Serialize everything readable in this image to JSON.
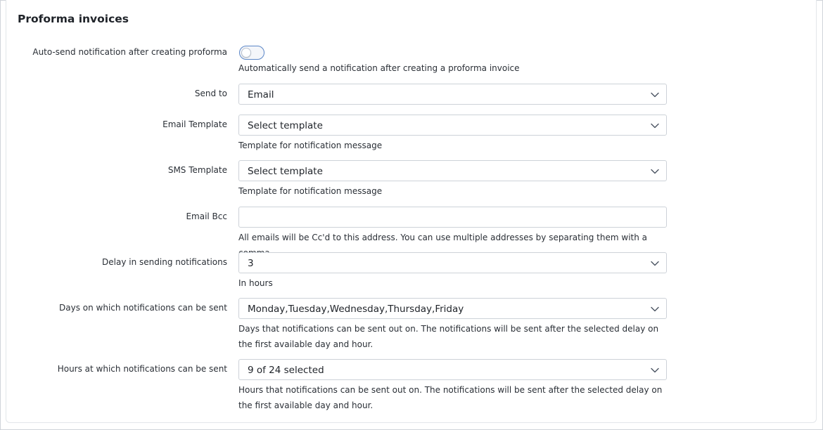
{
  "section": {
    "title": "Proforma invoices"
  },
  "auto_send": {
    "label": "Auto-send notification after creating proforma",
    "enabled": false,
    "help": "Automatically send a notification after creating a proforma invoice"
  },
  "send_to": {
    "label": "Send to",
    "value": "Email"
  },
  "email_template": {
    "label": "Email Template",
    "value": "Select template",
    "help": "Template for notification message"
  },
  "sms_template": {
    "label": "SMS Template",
    "value": "Select template",
    "help": "Template for notification message"
  },
  "email_bcc": {
    "label": "Email Bcc",
    "value": "",
    "help": "All emails will be Cc'd to this address. You can use multiple addresses by separating them with a comma."
  },
  "delay": {
    "label": "Delay in sending notifications",
    "value": "3",
    "help": "In hours"
  },
  "days": {
    "label": "Days on which notifications can be sent",
    "value": "Monday,Tuesday,Wednesday,Thursday,Friday",
    "help": "Days that notifications can be sent out on. The notifications will be sent after the selected delay on the first available day and hour."
  },
  "hours": {
    "label": "Hours at which notifications can be sent",
    "value": "9 of 24 selected",
    "help": "Hours that notifications can be sent out on. The notifications will be sent after the selected delay on the first available day and hour."
  },
  "colors": {
    "toggle_border": "#5b86c7",
    "input_border": "#cdd2d8",
    "text": "#1f2329"
  },
  "icons": {
    "dropdown": "chevron-down-icon"
  }
}
